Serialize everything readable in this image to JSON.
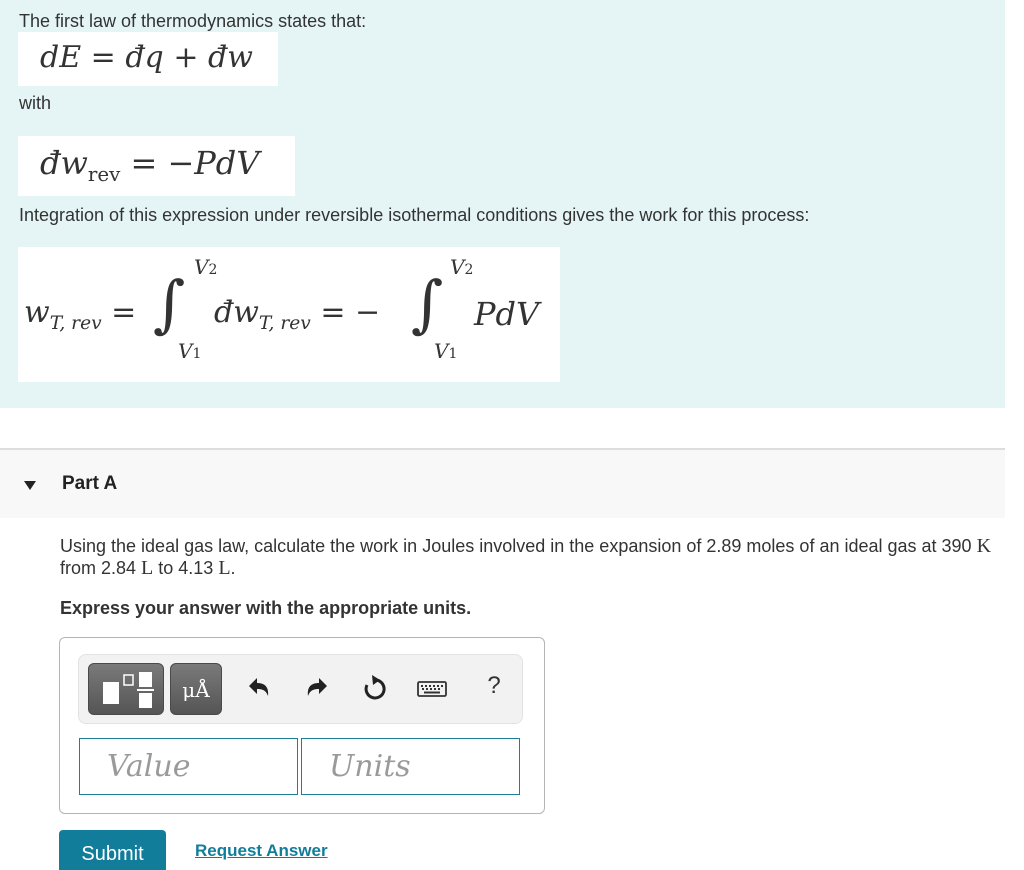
{
  "intro": {
    "line1": "The first law of thermodynamics states that:",
    "eq1": {
      "lhs": "dE",
      "equals": "=",
      "term1": "đq",
      "plus": "+",
      "term2": "đw"
    },
    "line2": "with",
    "eq2": {
      "lhs": "đw",
      "lhs_sub": "rev",
      "equals": "=",
      "rhs": "−PdV"
    },
    "line3": "Integration of this expression under reversible isothermal conditions gives the work for this process:",
    "eq3": {
      "lhs": "w",
      "lhs_sub": "T, rev",
      "equals1": "=",
      "integral": "∫",
      "upper": "V",
      "upper_sub": "2",
      "lower": "V",
      "lower_sub": "1",
      "integrand1": "đw",
      "integrand1_sub": "T, rev",
      "equals2": "=",
      "minus": "−",
      "integrand2": "PdV"
    }
  },
  "part": {
    "title": "Part A",
    "expanded": true,
    "question": {
      "pre": "Using the ideal gas law, calculate the work in Joules involved in the expansion of 2.89 moles of an ideal gas at 390 ",
      "unit_K": "K",
      "mid1": " from 2.84 ",
      "unit_L1": "L",
      "mid2": " to 4.13 ",
      "unit_L2": "L",
      "end": "."
    },
    "instruction": "Express your answer with the appropriate units."
  },
  "answer": {
    "toolbar": {
      "templates_icon": "templates-icon",
      "units_label": "μÅ",
      "undo_icon": "undo-icon",
      "redo_icon": "redo-icon",
      "reset_icon": "reset-icon",
      "keyboard_icon": "keyboard-icon",
      "help_label": "?"
    },
    "value_placeholder": "Value",
    "units_placeholder": "Units",
    "value": "",
    "units": ""
  },
  "actions": {
    "submit_label": "Submit",
    "request_label": "Request Answer"
  },
  "colors": {
    "intro_bg": "#e5f5f6",
    "accent": "#127d9b",
    "part_header_bg": "#f8f8f8"
  }
}
